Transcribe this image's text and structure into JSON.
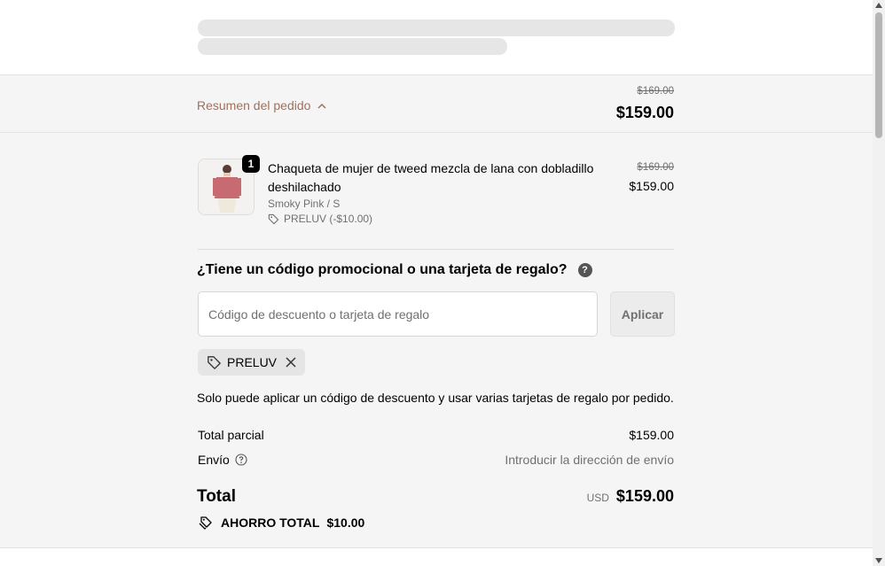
{
  "summary": {
    "toggle_label": "Resumen del pedido",
    "original_total": "$169.00",
    "total": "$159.00"
  },
  "item": {
    "quantity": "1",
    "name": "Chaqueta de mujer de tweed mezcla de lana con dobladillo deshilachado",
    "variant": "Smoky Pink / S",
    "discount": "PRELUV (-$10.00)",
    "original_price": "$169.00",
    "price": "$159.00"
  },
  "promo": {
    "title": "¿Tiene un código promocional o una tarjeta de regalo?",
    "input_placeholder": "Código de descuento o tarjeta de regalo",
    "input_value": "",
    "apply_label": "Aplicar",
    "applied_code": "PRELUV",
    "note": "Solo puede aplicar un código de descuento y usar varias tarjetas de regalo por pedido."
  },
  "totals": {
    "subtotal_label": "Total parcial",
    "subtotal_value": "$159.00",
    "shipping_label": "Envío",
    "shipping_value": "Introducir la dirección de envío",
    "total_label": "Total",
    "currency": "USD",
    "total_value": "$159.00",
    "savings_label": "AHORRO TOTAL",
    "savings_value": "$10.00"
  },
  "colors": {
    "accent": "#a0705b",
    "panel_bg": "#f5f5f5"
  }
}
